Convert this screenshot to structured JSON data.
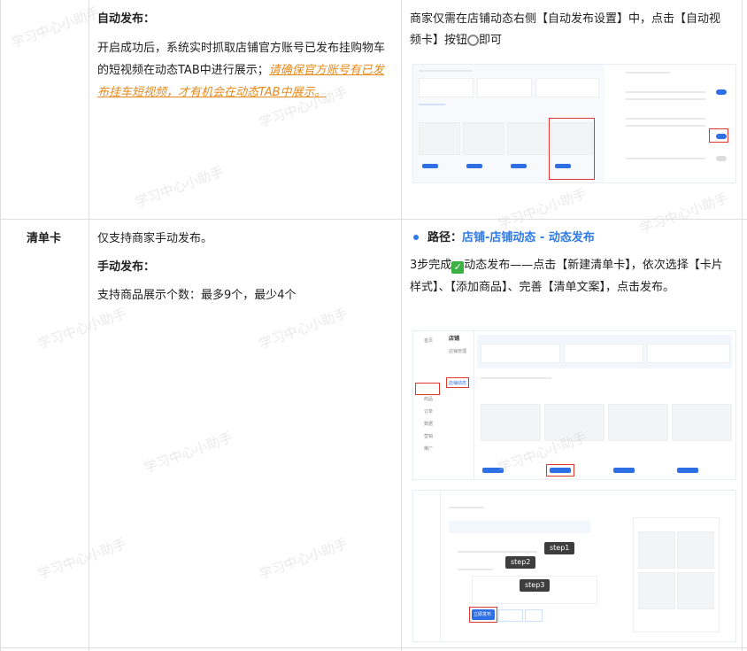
{
  "row1": {
    "heading": "自动发布：",
    "desc_plain": "开启成功后，系统实时抓取店铺官方账号已发布挂购物车的短视频在动态TAB中进行展示；",
    "desc_link": "请确保官方账号有已发布挂车短视频，才有机会在动态TAB中展示。",
    "right_text_1": "商家仅需在店铺动态右侧【自动发布设置】中，点击【自动视频卡】按钮",
    "right_text_2": "即可"
  },
  "row2": {
    "label": "清单卡",
    "line1": "仅支持商家手动发布。",
    "heading": "手动发布：",
    "line3": "支持商品展示个数：最多9个，最少4个",
    "path_label": "路径：",
    "path_value": "店铺-店铺动态 - 动态发布",
    "steps_text_1": "3步完成",
    "steps_text_2": "动态发布——点击【新建清单卡】，依次选择【卡片样式】、【添加商品】、完善【清单文案】，点击发布。"
  },
  "screenshot2": {
    "sidebar_title": "店铺",
    "sidebar_items": [
      "首页",
      "店铺管理",
      "店铺动态",
      "商品",
      "订单",
      "数据",
      "营销",
      "推广"
    ]
  },
  "screenshot3": {
    "step1": "step1",
    "step2": "step2",
    "step3": "step3",
    "publish_btn": "立即发布"
  },
  "watermark": "学习中心小助手",
  "icons": {
    "check": "check-icon",
    "toggle": "toggle-circle-icon",
    "bullet": "bullet-icon"
  },
  "colors": {
    "link_orange": "#e58a1b",
    "path_blue": "#2f7ae5",
    "highlight_red": "#e0382f"
  }
}
